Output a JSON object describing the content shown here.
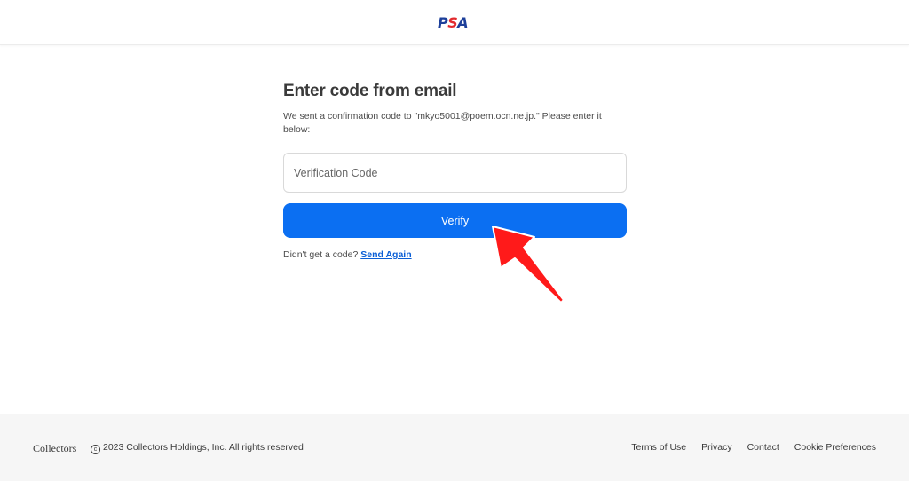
{
  "header": {
    "logo": {
      "p": "P",
      "s": "S",
      "a": "A"
    }
  },
  "main": {
    "title": "Enter code from email",
    "subtitle": "We sent a confirmation code to \"mkyo5001@poem.ocn.ne.jp.\" Please enter it below:",
    "input": {
      "placeholder": "Verification Code",
      "value": ""
    },
    "verify_label": "Verify",
    "resend_prompt": "Didn't get a code?",
    "resend_link": "Send Again"
  },
  "footer": {
    "brand": "Collectors",
    "copyright_symbol": "c",
    "copyright": "2023 Collectors Holdings, Inc. All rights reserved",
    "links": [
      "Terms of Use",
      "Privacy",
      "Contact",
      "Cookie Preferences"
    ]
  },
  "colors": {
    "accent": "#0b6ff2",
    "link": "#0b5fd6",
    "logo_blue": "#1d3f9a",
    "logo_red": "#e22a2e",
    "annotation_arrow": "#ff1a1a"
  },
  "icons": [
    "psa-logo",
    "copyright-icon",
    "red-arrow-annotation"
  ]
}
